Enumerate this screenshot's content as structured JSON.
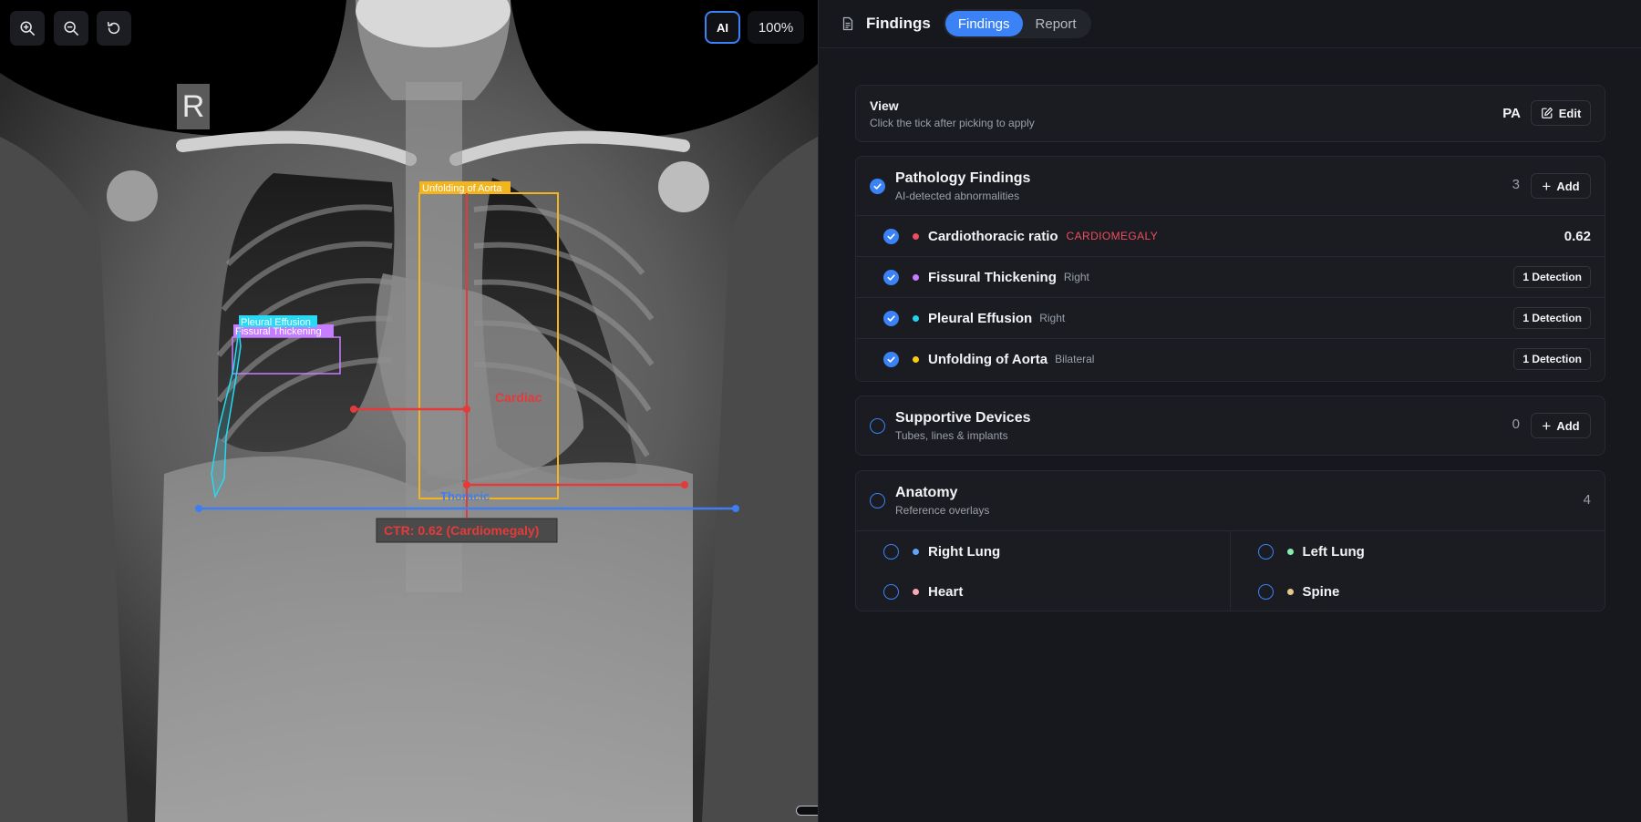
{
  "viewer": {
    "ai_label": "AI",
    "zoom": "100%",
    "side_marker": "R",
    "tools": [
      {
        "name": "zoom-in-icon"
      },
      {
        "name": "zoom-out-icon"
      },
      {
        "name": "reset-icon"
      }
    ],
    "annotations": {
      "aorta_label": "Unfolding of Aorta",
      "effusion_label": "Pleural Effusion",
      "fissural_label": "Fissural Thickening",
      "cardiac_label": "Cardiac",
      "thoracic_label": "Thoracic",
      "ctr_label": "CTR: 0.62 (Cardiomegaly)"
    },
    "colors": {
      "aorta": "#f2b51f",
      "effusion": "#29d8f2",
      "fissural": "#c77dff",
      "cardiac": "#e53a3a",
      "thoracic": "#3f7ef0"
    }
  },
  "panel": {
    "title": "Findings",
    "title_icon": "document-icon",
    "tabs": [
      {
        "label": "Findings",
        "active": true
      },
      {
        "label": "Report",
        "active": false
      }
    ],
    "view": {
      "title": "View",
      "subtitle": "Click the tick after picking to apply",
      "value": "PA",
      "edit_label": "Edit"
    },
    "pathology": {
      "title": "Pathology Findings",
      "subtitle": "AI-detected abnormalities",
      "count": "3",
      "add_label": "Add",
      "items": [
        {
          "name": "Cardiothoracic ratio",
          "tag": "CARDIOMEGALY",
          "value": "0.62",
          "color": "#ef4e5e"
        },
        {
          "name": "Fissural Thickening",
          "side": "Right",
          "detections": "1 Detection",
          "color": "#c77dff"
        },
        {
          "name": "Pleural Effusion",
          "side": "Right",
          "detections": "1 Detection",
          "color": "#22d3ee"
        },
        {
          "name": "Unfolding of Aorta",
          "side": "Bilateral",
          "detections": "1 Detection",
          "color": "#facc15"
        }
      ]
    },
    "devices": {
      "title": "Supportive Devices",
      "subtitle": "Tubes, lines & implants",
      "count": "0",
      "add_label": "Add"
    },
    "anatomy": {
      "title": "Anatomy",
      "subtitle": "Reference overlays",
      "count": "4",
      "items": [
        {
          "name": "Right Lung",
          "color": "#60a5fa"
        },
        {
          "name": "Left Lung",
          "color": "#86efac"
        },
        {
          "name": "Heart",
          "color": "#f9a8b8"
        },
        {
          "name": "Spine",
          "color": "#e5c890"
        }
      ]
    }
  }
}
